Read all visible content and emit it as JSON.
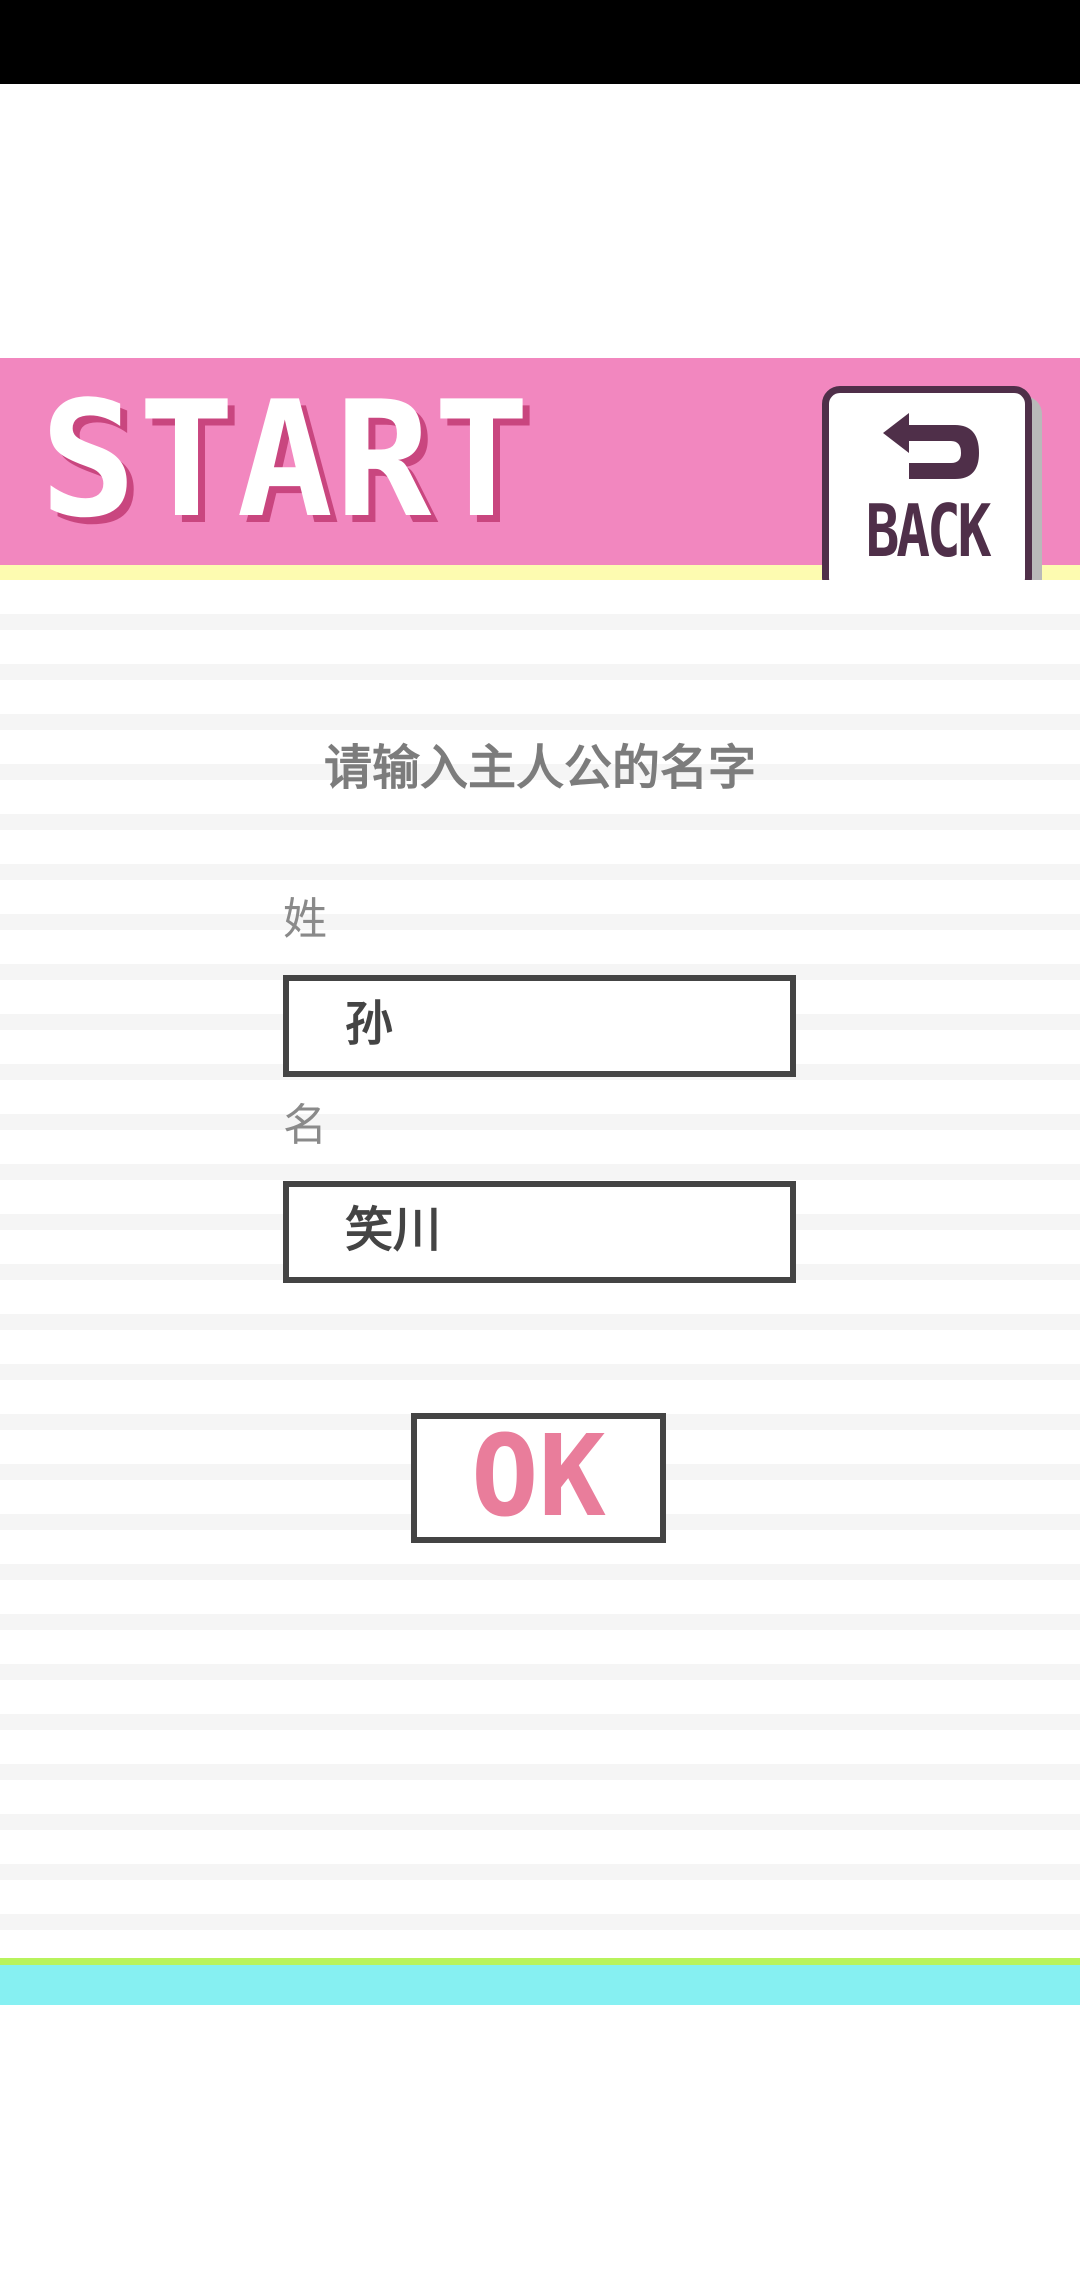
{
  "header": {
    "title": "START",
    "back_label": "BACK",
    "back_icon": "return-arrow-icon"
  },
  "form": {
    "prompt": "请输入主人公的名字",
    "surname_label": "姓",
    "surname_value": "孙",
    "given_label": "名",
    "given_value": "笑川",
    "ok_label": "OK"
  },
  "colors": {
    "header_bg": "#f287bf",
    "header_strip": "#fdfbb0",
    "title_shadow": "#c9467f",
    "back_outline": "#4f2f49",
    "ok_text": "#e97d9b",
    "bottom_line": "#b8f35c",
    "bottom_strip": "#86f0f2"
  }
}
